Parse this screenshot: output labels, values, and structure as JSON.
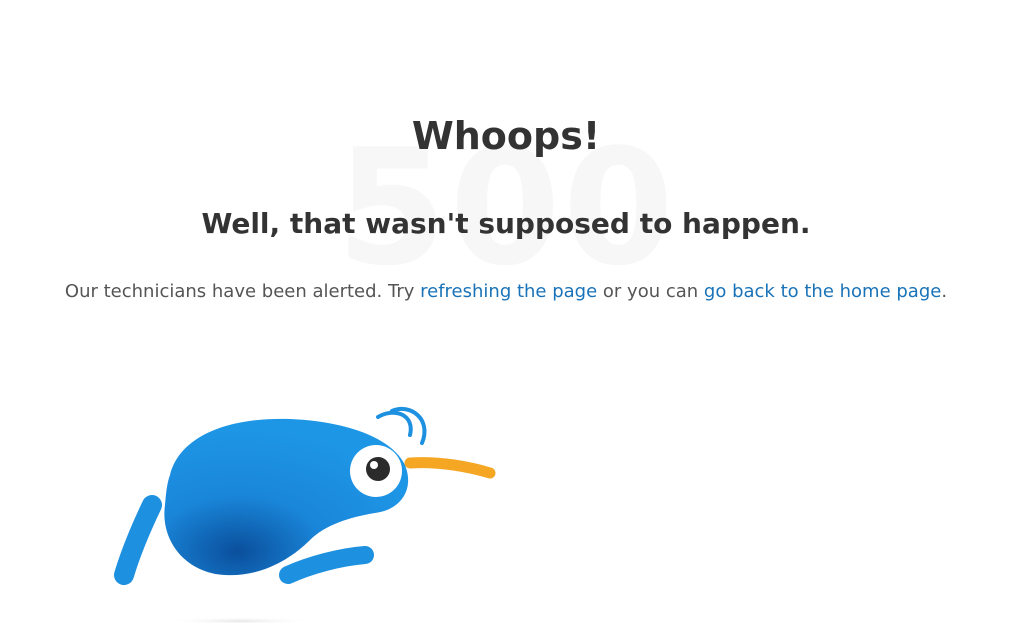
{
  "error": {
    "code": "500",
    "title": "Whoops!",
    "subtitle": "Well, that wasn't supposed to happen.",
    "message_prefix": "Our technicians have been alerted. Try ",
    "refresh_link": "refreshing the page",
    "message_middle": " or you can ",
    "home_link": "go back to the home page",
    "message_suffix": "."
  },
  "illustration": {
    "name": "kiwi-bird-mascot",
    "body_color": "#1a8fe0",
    "beak_color": "#f5a623"
  }
}
